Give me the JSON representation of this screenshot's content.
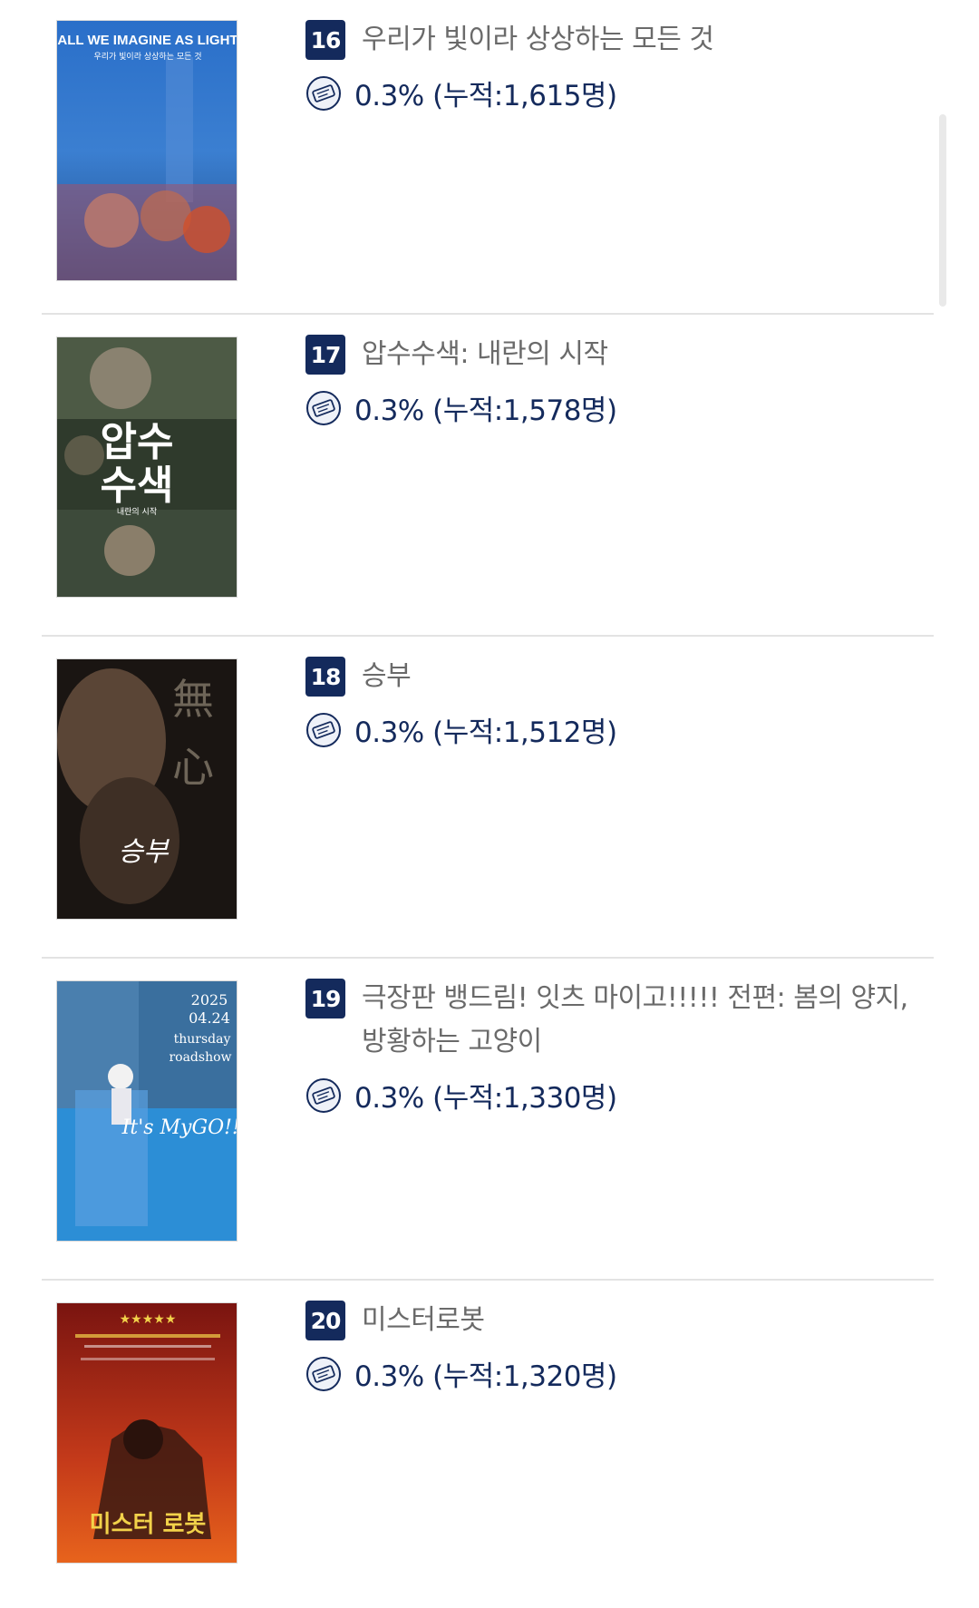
{
  "items": [
    {
      "rank": "16",
      "title": "우리가 빛이라 상상하는 모든 것",
      "stat": "0.3% (누적:1,615명)",
      "poster_text": "ALL WE IMAGINE AS LIGHT",
      "poster_subtext": "우리가 빛이라 상상하는 모든 것"
    },
    {
      "rank": "17",
      "title": "압수수색: 내란의 시작",
      "stat": "0.3% (누적:1,578명)",
      "poster_text": "압수\n수색",
      "poster_subtext": "내란의 시작"
    },
    {
      "rank": "18",
      "title": "승부",
      "stat": "0.3% (누적:1,512명)",
      "poster_text": "無心",
      "poster_subtext": "승부"
    },
    {
      "rank": "19",
      "title": "극장판 뱅드림! 잇츠 마이고!!!!! 전편: 봄의 양지, 방황하는 고양이",
      "stat": "0.3% (누적:1,330명)",
      "poster_text": "2025\n04.24\nthursday\nroadshow",
      "poster_subtext": ""
    },
    {
      "rank": "20",
      "title": "미스터로봇",
      "stat": "0.3% (누적:1,320명)",
      "poster_text": "★★★★★",
      "poster_subtext": "미스터 로봇"
    }
  ],
  "colors": {
    "rank_bg": "#142a5c",
    "stat_text": "#142a5c",
    "title_text": "#6a6a6a",
    "divider": "#e3e3e3"
  },
  "icons": {
    "stat_icon": "ticket-icon"
  }
}
